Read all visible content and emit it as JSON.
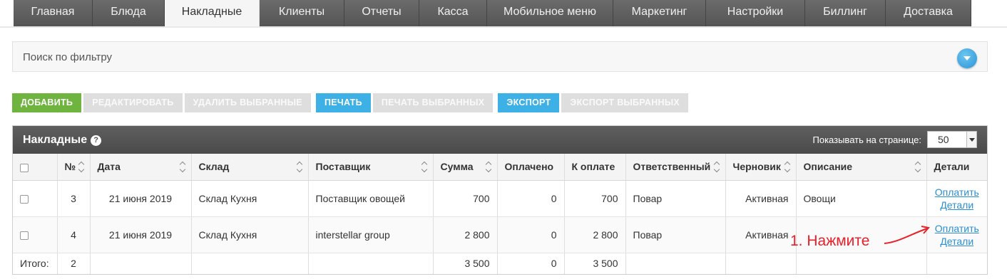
{
  "nav": {
    "tabs": [
      {
        "label": "Главная",
        "active": false
      },
      {
        "label": "Блюда",
        "active": false
      },
      {
        "label": "Накладные",
        "active": true
      },
      {
        "label": "Клиенты",
        "active": false
      },
      {
        "label": "Отчеты",
        "active": false
      },
      {
        "label": "Касса",
        "active": false
      },
      {
        "label": "Мобильное меню",
        "active": false
      },
      {
        "label": "Маркетинг",
        "active": false
      },
      {
        "label": "Настройки",
        "active": false
      },
      {
        "label": "Биллинг",
        "active": false
      },
      {
        "label": "Доставка",
        "active": false
      }
    ]
  },
  "filter": {
    "label": "Поиск по фильтру"
  },
  "toolbar": {
    "add": "ДОБАВИТЬ",
    "edit": "РЕДАКТИРОВАТЬ",
    "delete_selected": "УДАЛИТЬ ВЫБРАННЫЕ",
    "print": "ПЕЧАТЬ",
    "print_selected": "ПЕЧАТЬ ВЫБРАННЫХ",
    "export": "ЭКСПОРТ",
    "export_selected": "ЭКСПОРТ ВЫБРАННЫХ"
  },
  "panel": {
    "title": "Накладные",
    "help_icon": "?",
    "per_page_label": "Показывать на странице:",
    "per_page_value": "50"
  },
  "table": {
    "headers": {
      "num": "№",
      "date": "Дата",
      "warehouse": "Склад",
      "supplier": "Поставщик",
      "sum": "Сумма",
      "paid": "Оплачено",
      "to_pay": "К оплате",
      "responsible": "Ответственный",
      "draft": "Черновик",
      "description": "Описание",
      "details": "Детали"
    },
    "rows": [
      {
        "num": "3",
        "date": "21 июня 2019",
        "warehouse": "Склад Кухня",
        "supplier": "Поставщик овощей",
        "sum": "700",
        "paid": "0",
        "to_pay": "700",
        "responsible": "Повар",
        "draft": "Активная",
        "description": "Овощи",
        "pay_link": "Оплатить",
        "details_link": "Детали"
      },
      {
        "num": "4",
        "date": "21 июня 2019",
        "warehouse": "Склад Кухня",
        "supplier": "interstellar group",
        "sum": "2 800",
        "paid": "0",
        "to_pay": "2 800",
        "responsible": "Повар",
        "draft": "Активная",
        "description": "",
        "pay_link": "Оплатить",
        "details_link": "Детали"
      }
    ],
    "footer": {
      "label": "Итого:",
      "count": "2",
      "sum": "3 500",
      "paid": "0",
      "to_pay": "3 500"
    }
  },
  "annotation": {
    "text": "1. Нажмите",
    "color": "#e8202a"
  }
}
